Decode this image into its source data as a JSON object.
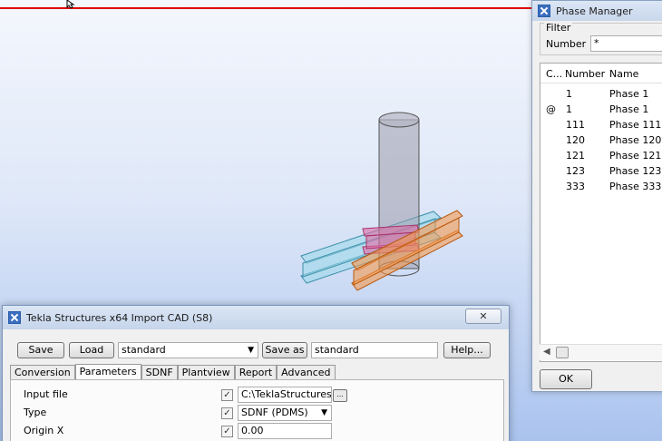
{
  "phase_manager": {
    "title": "Phase Manager",
    "filter_label": "Filter",
    "number_label": "Number",
    "number_value": "*",
    "columns": [
      "C...",
      "Number",
      "Name"
    ],
    "rows": [
      {
        "current": "",
        "number": "1",
        "name": "Phase 1"
      },
      {
        "current": "@",
        "number": "1",
        "name": "Phase 1"
      },
      {
        "current": "",
        "number": "111",
        "name": "Phase 111"
      },
      {
        "current": "",
        "number": "120",
        "name": "Phase 120"
      },
      {
        "current": "",
        "number": "121",
        "name": "Phase 121"
      },
      {
        "current": "",
        "number": "123",
        "name": "Phase 123"
      },
      {
        "current": "",
        "number": "333",
        "name": "Phase 333"
      }
    ],
    "ok_label": "OK"
  },
  "import_dialog": {
    "title": "Tekla Structures x64  Import CAD (S8)",
    "close_glyph": "✕",
    "save_label": "Save",
    "load_label": "Load",
    "load_value": "standard",
    "save_as_label": "Save as",
    "save_as_value": "standard",
    "help_label": "Help...",
    "tabs": [
      "Conversion",
      "Parameters",
      "SDNF",
      "Plantview",
      "Report",
      "Advanced"
    ],
    "active_tab": "Parameters",
    "params": [
      {
        "label": "Input file",
        "checked": true,
        "value": "C:\\TeklaStructuresMod"
      },
      {
        "label": "Type",
        "checked": true,
        "value": "SDNF (PDMS)"
      },
      {
        "label": "Origin X",
        "checked": true,
        "value": "0.00"
      }
    ]
  },
  "icons": [
    "app-icon",
    "close-icon",
    "cursor-icon",
    "dropdown-icon",
    "browse-icon",
    "checkbox-icon"
  ],
  "colors": {
    "red_guide_line": "#e00000",
    "column": "#8e8e9a",
    "beam_cyan": "#5bb8d0",
    "beam_orange": "#e8761e",
    "beam_magenta": "#d24a8c"
  }
}
